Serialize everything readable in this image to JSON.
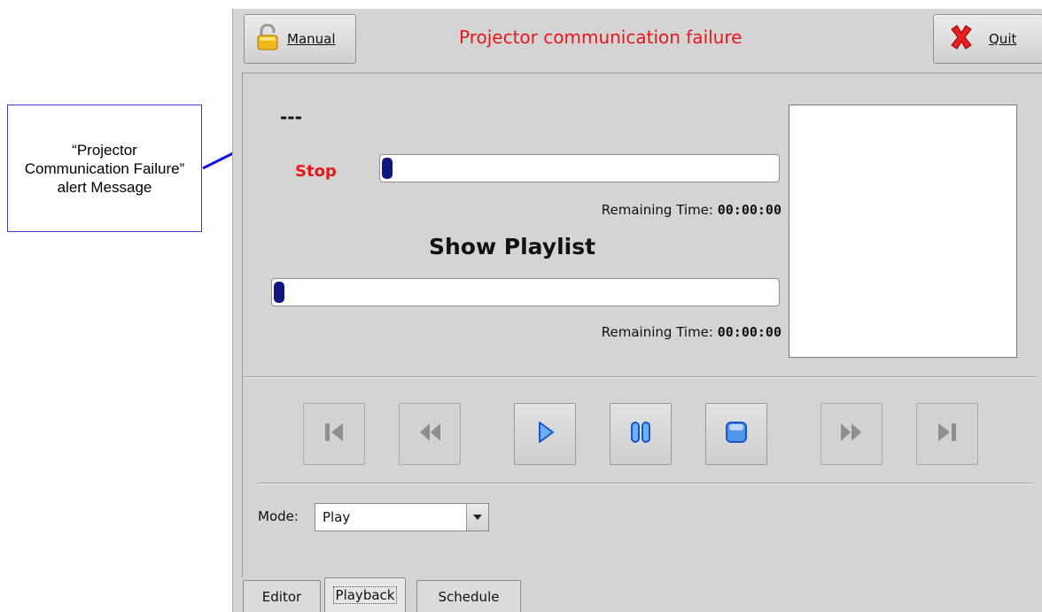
{
  "annotation": {
    "callout_text": "“Projector Communication Failure” alert Message"
  },
  "topbar": {
    "manual_label": "Manual",
    "alert_message": "Projector communication failure",
    "quit_label": "Quit"
  },
  "now_playing": {
    "title": "---",
    "status": "Stop",
    "progress": 0,
    "remaining_label": "Remaining Time:",
    "remaining_value": "00:00:00"
  },
  "playlist": {
    "title": "Show Playlist",
    "progress": 0,
    "remaining_label": "Remaining Time:",
    "remaining_value": "00:00:00"
  },
  "transport": [
    {
      "name": "skip-to-start",
      "enabled": false
    },
    {
      "name": "rewind",
      "enabled": false
    },
    {
      "name": "play",
      "enabled": true
    },
    {
      "name": "pause",
      "enabled": true
    },
    {
      "name": "stop",
      "enabled": true
    },
    {
      "name": "fast-forward",
      "enabled": false
    },
    {
      "name": "skip-to-end",
      "enabled": false
    }
  ],
  "mode": {
    "label": "Mode:",
    "value": "Play"
  },
  "tabs": [
    {
      "label": "Editor",
      "active": false
    },
    {
      "label": "Playback",
      "active": true
    },
    {
      "label": "Schedule",
      "active": false
    }
  ],
  "colors": {
    "alert": "#e8171b",
    "progress_fill": "#101880",
    "transport_blue": "#1a66d8",
    "arrow": "#1010e0"
  }
}
